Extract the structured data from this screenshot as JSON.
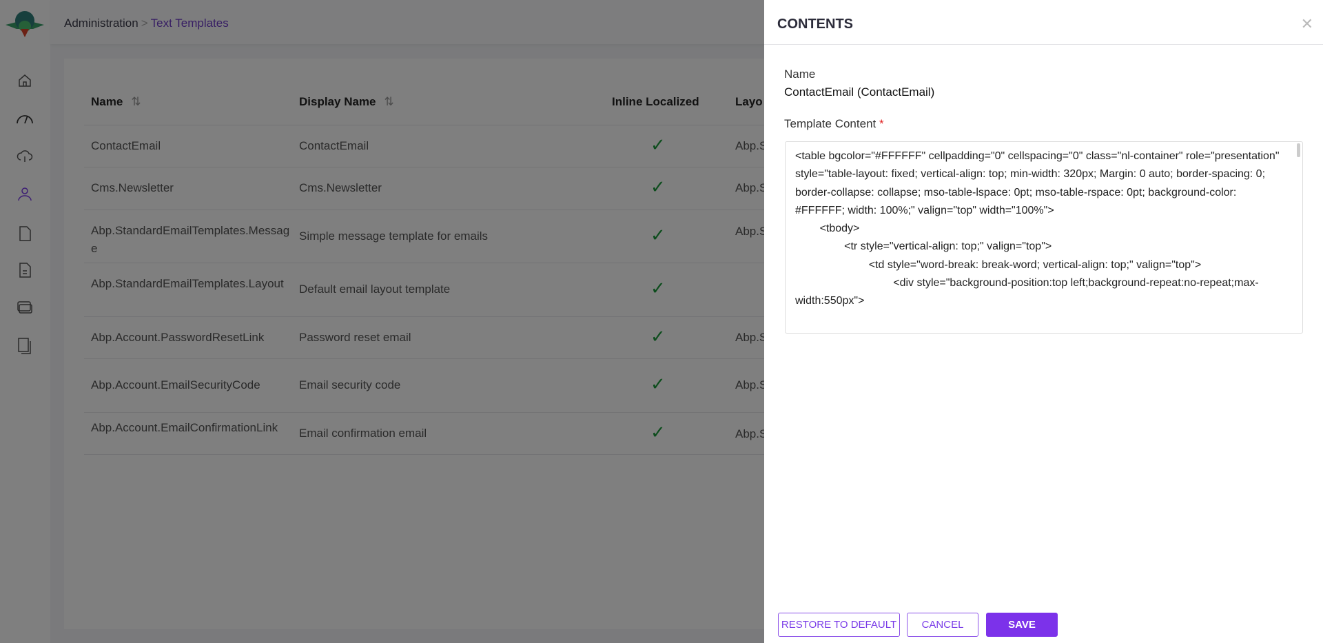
{
  "breadcrumb": {
    "parent": "Administration",
    "separator": ">",
    "current": "Text Templates"
  },
  "sidebar": {
    "items": [
      {
        "icon": "home-icon"
      },
      {
        "icon": "dashboard-gauge-icon"
      },
      {
        "icon": "cloud-icon"
      },
      {
        "icon": "users-icon",
        "active": true
      },
      {
        "icon": "file-icon"
      },
      {
        "icon": "document-icon"
      },
      {
        "icon": "card-icon"
      },
      {
        "icon": "copy-icon"
      }
    ]
  },
  "table": {
    "headers": {
      "name": "Name",
      "display_name": "Display Name",
      "inline_localized": "Inline Localized",
      "layout": "Layo"
    },
    "sort_glyph": "⇅",
    "rows": [
      {
        "name": "ContactEmail",
        "display_name": "ContactEmail",
        "inline_localized": true,
        "layout": "Abp.S"
      },
      {
        "name": "Cms.Newsletter",
        "display_name": "Cms.Newsletter",
        "inline_localized": true,
        "layout": "Abp.S"
      },
      {
        "name": "Abp.StandardEmailTemplates.Message",
        "display_name": "Simple message template for emails",
        "inline_localized": true,
        "layout": "Abp.S"
      },
      {
        "name": "Abp.StandardEmailTemplates.Layout",
        "display_name": "Default email layout template",
        "inline_localized": true,
        "layout": ""
      },
      {
        "name": "Abp.Account.PasswordResetLink",
        "display_name": "Password reset email",
        "inline_localized": true,
        "layout": "Abp.S"
      },
      {
        "name": "Abp.Account.EmailSecurityCode",
        "display_name": "Email security code",
        "inline_localized": true,
        "layout": "Abp.S"
      },
      {
        "name": "Abp.Account.EmailConfirmationLink",
        "display_name": "Email confirmation email",
        "inline_localized": true,
        "layout": "Abp.S"
      }
    ]
  },
  "panel": {
    "title": "CONTENTS",
    "name_label": "Name",
    "name_value": "ContactEmail (ContactEmail)",
    "content_label": "Template Content",
    "required_mark": "*",
    "content_value": "<table bgcolor=\"#FFFFFF\" cellpadding=\"0\" cellspacing=\"0\" class=\"nl-container\" role=\"presentation\" style=\"table-layout: fixed; vertical-align: top; min-width: 320px; Margin: 0 auto; border-spacing: 0; border-collapse: collapse; mso-table-lspace: 0pt; mso-table-rspace: 0pt; background-color: #FFFFFF; width: 100%;\" valign=\"top\" width=\"100%\">\n        <tbody>\n                <tr style=\"vertical-align: top;\" valign=\"top\">\n                        <td style=\"word-break: break-word; vertical-align: top;\" valign=\"top\">\n                                <div style=\"background-position:top left;background-repeat:no-repeat;max-width:550px\">",
    "buttons": {
      "restore": "RESTORE TO DEFAULT",
      "cancel": "CANCEL",
      "save": "SAVE"
    }
  },
  "colors": {
    "accent": "#7c32ea",
    "check": "#1a9a3a"
  }
}
